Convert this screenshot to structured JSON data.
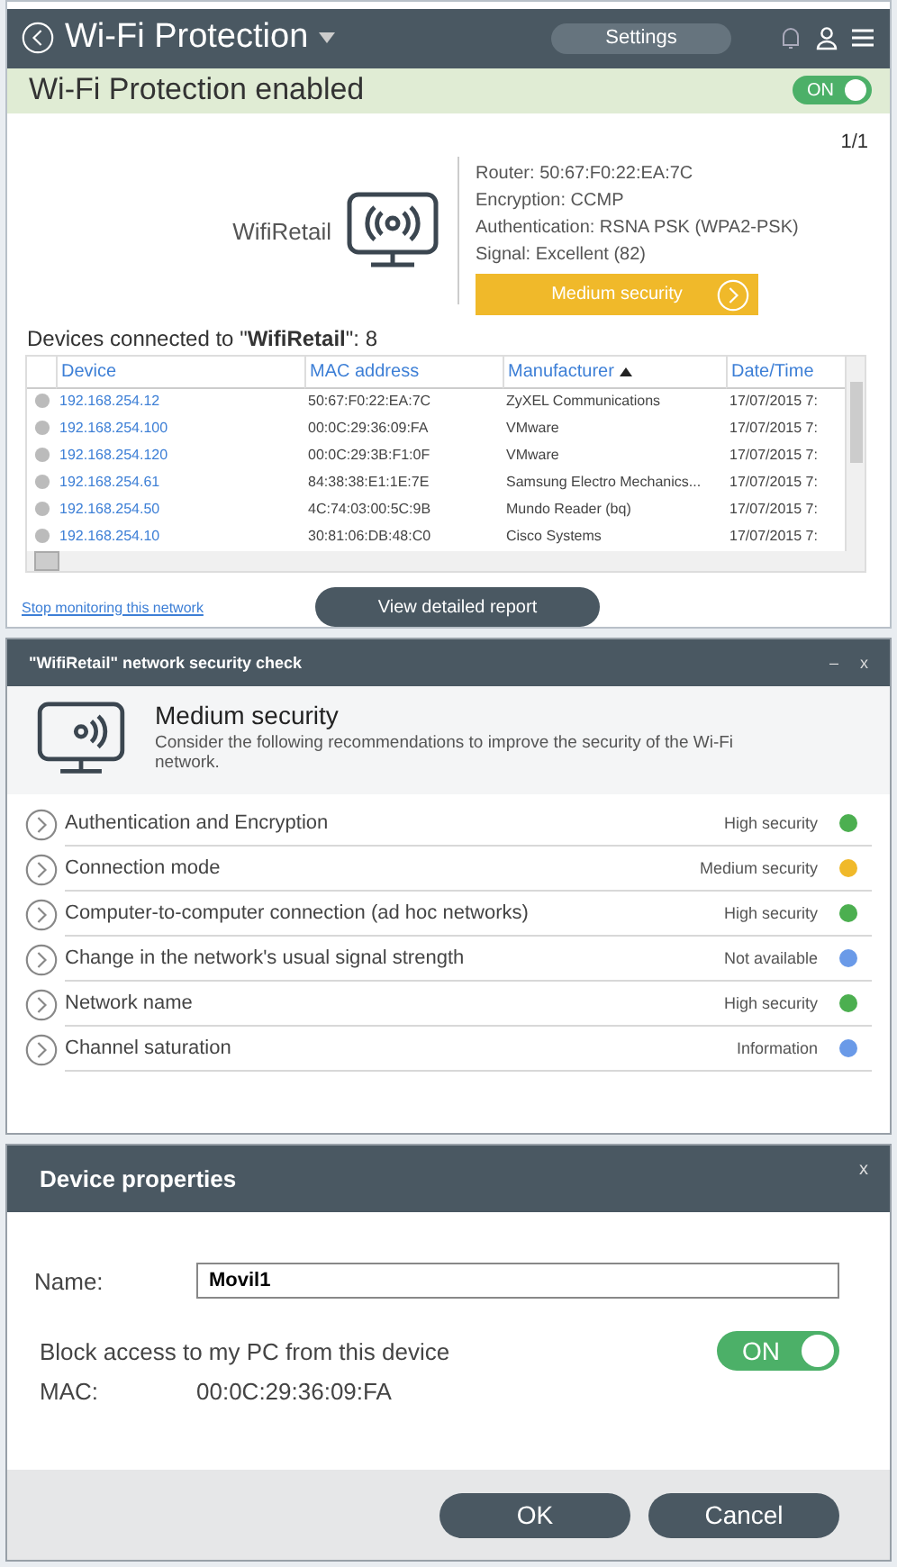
{
  "header": {
    "title": "Wi-Fi Protection",
    "settings": "Settings"
  },
  "status": {
    "text": "Wi-Fi Protection enabled",
    "toggle": {
      "label": "ON",
      "on": true
    }
  },
  "network": {
    "name": "WifiRetail",
    "page": "1/1",
    "details": [
      "Router: 50:67:F0:22:EA:7C",
      "Encryption: CCMP",
      "Authentication: RSNA PSK (WPA2-PSK)",
      "Signal: Excellent (82)"
    ],
    "security_button": "Medium security"
  },
  "devices": {
    "caption": "Devices connected to \"**WifiRetail**\": 8",
    "columns": [
      {
        "label": "Device",
        "sorted": false
      },
      {
        "label": "MAC address",
        "sorted": false
      },
      {
        "label": "Manufacturer",
        "sorted": true
      },
      {
        "label": "Date/Time",
        "sorted": false
      }
    ],
    "rows": [
      {
        "device": "192.168.254.12",
        "mac": "50:67:F0:22:EA:7C",
        "manufacturer": "ZyXEL Communications",
        "date": "17/07/2015 7:"
      },
      {
        "device": "192.168.254.100",
        "mac": "00:0C:29:36:09:FA",
        "manufacturer": "VMware",
        "date": "17/07/2015 7:"
      },
      {
        "device": "192.168.254.120",
        "mac": "00:0C:29:3B:F1:0F",
        "manufacturer": "VMware",
        "date": "17/07/2015 7:"
      },
      {
        "device": "192.168.254.61",
        "mac": "84:38:38:E1:1E:7E",
        "manufacturer": "Samsung Electro Mechanics...",
        "date": "17/07/2015 7:"
      },
      {
        "device": "192.168.254.50",
        "mac": "4C:74:03:00:5C:9B",
        "manufacturer": "Mundo Reader (bq)",
        "date": "17/07/2015 7:"
      },
      {
        "device": "192.168.254.10",
        "mac": "30:81:06:DB:48:C0",
        "manufacturer": "Cisco Systems",
        "date": "17/07/2015 7:"
      }
    ],
    "stop_link": "Stop monitoring this network",
    "report_button": "View detailed report"
  },
  "check_dialog": {
    "title": "\"WifiRetail\" network security check",
    "minimize": "–",
    "close": "x",
    "heading": "Medium security",
    "description": "Consider the following recommendations to improve the security of the Wi-Fi network.",
    "items": [
      {
        "label": "Authentication and Encryption",
        "status": "High security",
        "color": "#4caf50"
      },
      {
        "label": "Connection mode",
        "status": "Medium security",
        "color": "#f0b92a"
      },
      {
        "label": "Computer-to-computer connection (ad hoc networks)",
        "status": "High security",
        "color": "#4caf50"
      },
      {
        "label": "Change in the network's usual signal strength",
        "status": "Not available",
        "color": "#6a9ae8"
      },
      {
        "label": "Network name",
        "status": "High security",
        "color": "#4caf50"
      },
      {
        "label": "Channel saturation",
        "status": "Information",
        "color": "#6a9ae8"
      }
    ]
  },
  "properties_dialog": {
    "title": "Device properties",
    "close": "x",
    "name_label": "Name:",
    "name_value": "Movil1",
    "block_label": "Block access to my PC from this device",
    "toggle": {
      "label": "ON",
      "on": true
    },
    "mac_label": "MAC:",
    "mac_value": "00:0C:29:36:09:FA",
    "buttons": [
      "OK",
      "Cancel"
    ]
  }
}
